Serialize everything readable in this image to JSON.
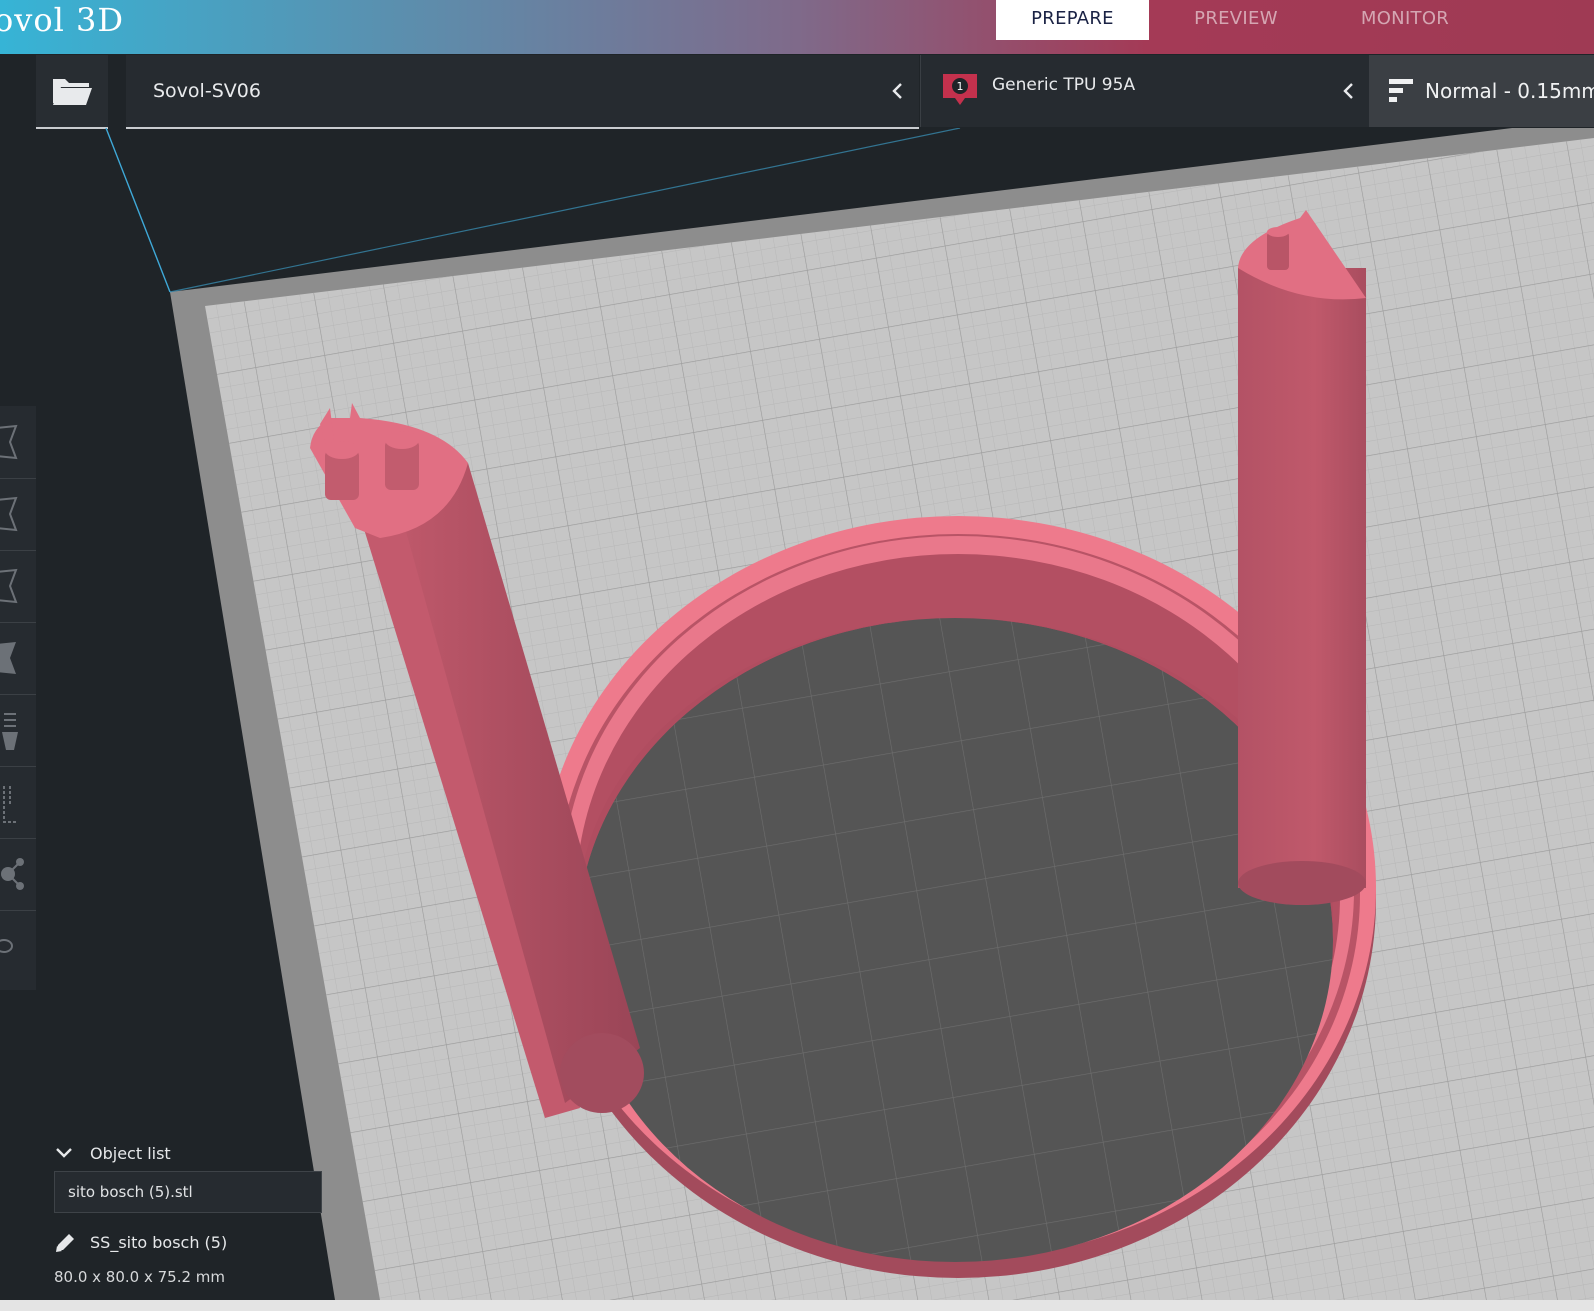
{
  "header": {
    "brand": "ovol 3D",
    "stages": [
      {
        "label": "PREPARE",
        "active": true
      },
      {
        "label": "PREVIEW",
        "active": false
      },
      {
        "label": "MONITOR",
        "active": false
      }
    ]
  },
  "toolbar": {
    "open_icon": "folder-open-icon",
    "printer": {
      "label": "Sovol-SV06"
    },
    "material": {
      "badge": "1",
      "label": "Generic TPU 95A"
    },
    "quality": {
      "label": "Normal - 0.15mm"
    }
  },
  "object_list": {
    "title": "Object list",
    "file": "sito bosch (5).stl",
    "object_name": "SS_sito bosch (5)",
    "dimensions": "80.0 x 80.0 x 75.2 mm"
  },
  "colors": {
    "accent": "#1a2244",
    "model": "#e06c80",
    "plate": "#c6c6c6",
    "panel": "#262b30"
  }
}
